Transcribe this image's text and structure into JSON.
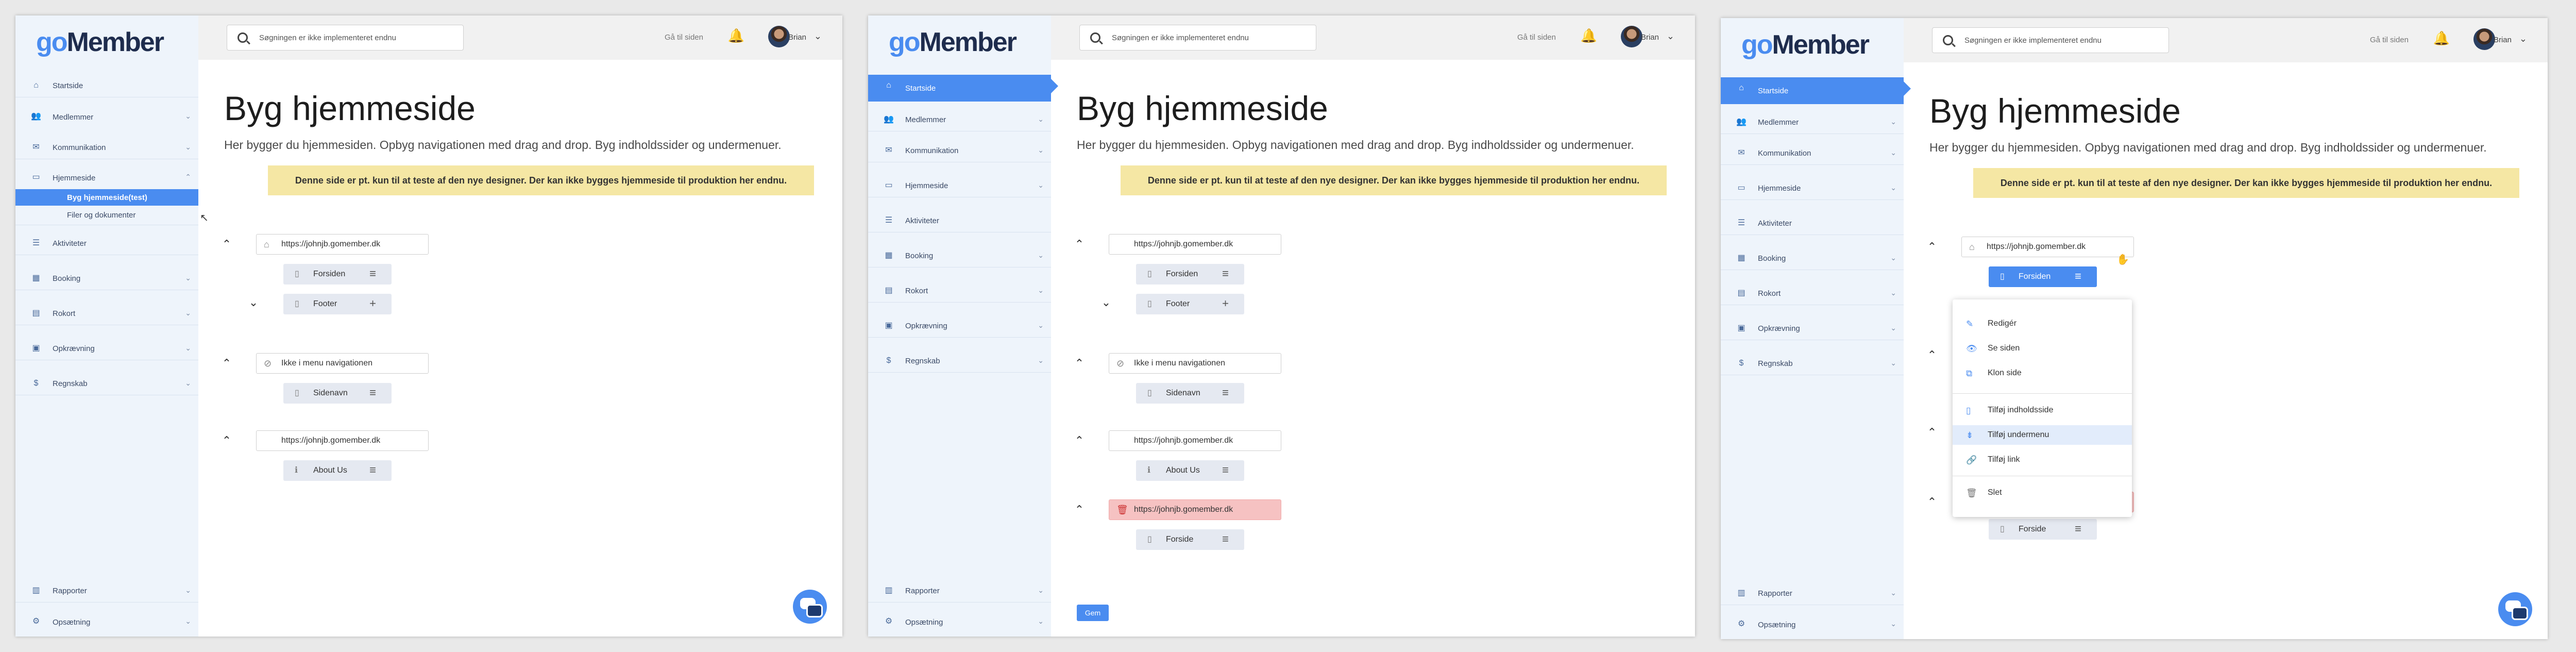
{
  "logo": {
    "go": "go",
    "rest": "Member"
  },
  "search_placeholder": "Søgningen er ikke implementeret endnu",
  "header": {
    "goto": "Gå til siden",
    "user": "Brian"
  },
  "page": {
    "title": "Byg hjemmeside",
    "lead": "Her bygger du hjemmesiden. Opbyg navigationen med drag and drop. Byg indholdssider og undermenuer.",
    "banner": "Denne side er pt. kun til at teste af den nye designer. Der kan ikke bygges hjemmeside til produktion her endnu."
  },
  "nav": {
    "startside": "Startside",
    "medlemmer": "Medlemmer",
    "kommunikation": "Kommunikation",
    "hjemmeside": "Hjemmeside",
    "byg": "Byg hjemmeside(test)",
    "filer": "Filer og dokumenter",
    "aktiviteter": "Aktiviteter",
    "booking": "Booking",
    "rokort": "Rokort",
    "opkraevning": "Opkrævning",
    "regnskab": "Regnskab",
    "rapporter": "Rapporter",
    "opsaetning": "Opsætning"
  },
  "tree": {
    "url1": "https://johnjb.gomember.dk",
    "forsiden": "Forsiden",
    "footer": "Footer",
    "not_in_menu": "Ikke i menu navigationen",
    "sidenavn": "Sidenavn",
    "url2": "https://johnjb.gomember.dk",
    "about": "About Us",
    "url3": "https://johnjb.gomember.dk",
    "forside": "Forside"
  },
  "save": "Gem",
  "context_menu": {
    "rediger": "Redigér",
    "se": "Se siden",
    "klon": "Klon side",
    "indhold": "Tilføj indholdsside",
    "undermenu": "Tilføj undermenu",
    "link": "Tilføj link",
    "slet": "Slet"
  },
  "icons": {
    "home": "home-icon",
    "search": "search-icon",
    "bell": "bell-icon",
    "chat": "chat-icon"
  },
  "colors": {
    "accent": "#4a8cf0",
    "banner": "#f5e7a4",
    "danger": "#f6c2c2",
    "sidebar": "#eef4fb"
  }
}
